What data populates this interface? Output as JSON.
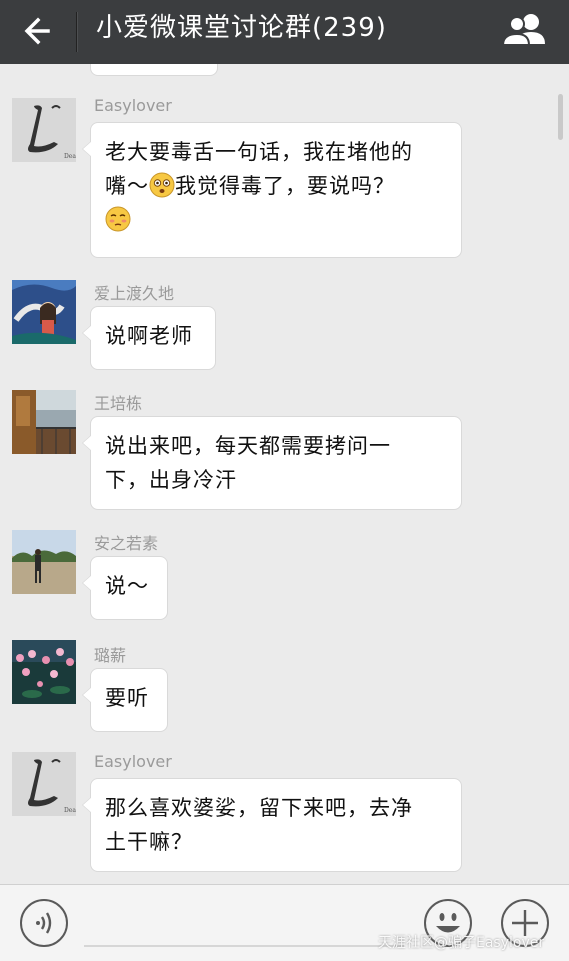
{
  "header": {
    "back_icon": "arrow-left-icon",
    "title": "小爱微课堂讨论群(239)",
    "members_icon": "group-members-icon"
  },
  "messages": [
    {
      "sender": "Easylover",
      "avatar": "death-note-L-avatar",
      "text_lines": [
        "老大要毒舌一句话，我在堵他的",
        "嘴～",
        "我觉得毒了，要说吗？"
      ],
      "emojis": [
        "shocked-emoji",
        "blushing-emoji"
      ]
    },
    {
      "sender": "爱上渡久地",
      "avatar": "spirited-away-avatar",
      "text": "说啊老师"
    },
    {
      "sender": "王培栋",
      "avatar": "balcony-photo-avatar",
      "text_lines": [
        "说出来吧，每天都需要拷问一",
        "下，出身冷汗"
      ]
    },
    {
      "sender": "安之若素",
      "avatar": "person-outdoor-avatar",
      "text": "说～"
    },
    {
      "sender": "璐薪",
      "avatar": "lotus-pond-avatar",
      "text": "要听"
    },
    {
      "sender": "Easylover",
      "avatar": "death-note-L-avatar",
      "text_lines": [
        "那么喜欢婆娑，留下来吧，去净",
        "土干嘛？"
      ]
    }
  ],
  "footer": {
    "voice_icon": "voice-input-icon",
    "emoji_icon": "smiley-face-icon",
    "plus_icon": "plus-icon"
  },
  "watermark": "天涯社区@骗子Easylover",
  "colors": {
    "topbar": "#3b3d3f",
    "chat_background": "#ebebeb",
    "bubble": "#ffffff",
    "sender_name": "#9a9a9a"
  }
}
